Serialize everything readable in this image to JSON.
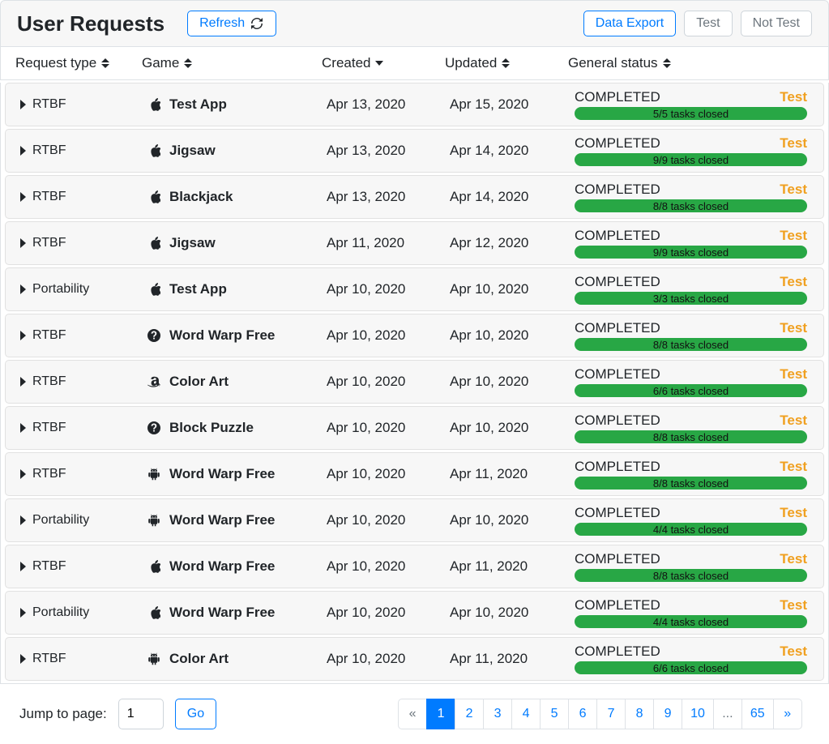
{
  "header": {
    "title": "User Requests",
    "refresh_label": "Refresh",
    "export_label": "Data Export",
    "test_label": "Test",
    "not_test_label": "Not Test"
  },
  "columns": {
    "type": "Request type",
    "game": "Game",
    "created": "Created",
    "updated": "Updated",
    "status": "General status"
  },
  "rows": [
    {
      "type": "RTBF",
      "platform": "apple",
      "game": "Test App",
      "created": "Apr 13, 2020",
      "updated": "Apr 15, 2020",
      "status": "COMPLETED",
      "badge": "Test",
      "tasks": "5/5 tasks closed"
    },
    {
      "type": "RTBF",
      "platform": "apple",
      "game": "Jigsaw",
      "created": "Apr 13, 2020",
      "updated": "Apr 14, 2020",
      "status": "COMPLETED",
      "badge": "Test",
      "tasks": "9/9 tasks closed"
    },
    {
      "type": "RTBF",
      "platform": "apple",
      "game": "Blackjack",
      "created": "Apr 13, 2020",
      "updated": "Apr 14, 2020",
      "status": "COMPLETED",
      "badge": "Test",
      "tasks": "8/8 tasks closed"
    },
    {
      "type": "RTBF",
      "platform": "apple",
      "game": "Jigsaw",
      "created": "Apr 11, 2020",
      "updated": "Apr 12, 2020",
      "status": "COMPLETED",
      "badge": "Test",
      "tasks": "9/9 tasks closed"
    },
    {
      "type": "Portability",
      "platform": "apple",
      "game": "Test App",
      "created": "Apr 10, 2020",
      "updated": "Apr 10, 2020",
      "status": "COMPLETED",
      "badge": "Test",
      "tasks": "3/3 tasks closed"
    },
    {
      "type": "RTBF",
      "platform": "help",
      "game": "Word Warp Free",
      "created": "Apr 10, 2020",
      "updated": "Apr 10, 2020",
      "status": "COMPLETED",
      "badge": "Test",
      "tasks": "8/8 tasks closed"
    },
    {
      "type": "RTBF",
      "platform": "amazon",
      "game": "Color Art",
      "created": "Apr 10, 2020",
      "updated": "Apr 10, 2020",
      "status": "COMPLETED",
      "badge": "Test",
      "tasks": "6/6 tasks closed"
    },
    {
      "type": "RTBF",
      "platform": "help",
      "game": "Block Puzzle",
      "created": "Apr 10, 2020",
      "updated": "Apr 10, 2020",
      "status": "COMPLETED",
      "badge": "Test",
      "tasks": "8/8 tasks closed"
    },
    {
      "type": "RTBF",
      "platform": "android",
      "game": "Word Warp Free",
      "created": "Apr 10, 2020",
      "updated": "Apr 11, 2020",
      "status": "COMPLETED",
      "badge": "Test",
      "tasks": "8/8 tasks closed"
    },
    {
      "type": "Portability",
      "platform": "android",
      "game": "Word Warp Free",
      "created": "Apr 10, 2020",
      "updated": "Apr 10, 2020",
      "status": "COMPLETED",
      "badge": "Test",
      "tasks": "4/4 tasks closed"
    },
    {
      "type": "RTBF",
      "platform": "apple",
      "game": "Word Warp Free",
      "created": "Apr 10, 2020",
      "updated": "Apr 11, 2020",
      "status": "COMPLETED",
      "badge": "Test",
      "tasks": "8/8 tasks closed"
    },
    {
      "type": "Portability",
      "platform": "apple",
      "game": "Word Warp Free",
      "created": "Apr 10, 2020",
      "updated": "Apr 10, 2020",
      "status": "COMPLETED",
      "badge": "Test",
      "tasks": "4/4 tasks closed"
    },
    {
      "type": "RTBF",
      "platform": "android",
      "game": "Color Art",
      "created": "Apr 10, 2020",
      "updated": "Apr 11, 2020",
      "status": "COMPLETED",
      "badge": "Test",
      "tasks": "6/6 tasks closed"
    }
  ],
  "pager": {
    "jump_label": "Jump to page:",
    "jump_value": "1",
    "go_label": "Go",
    "ellipsis": "...",
    "pages": [
      "1",
      "2",
      "3",
      "4",
      "5",
      "6",
      "7",
      "8",
      "9",
      "10"
    ],
    "last": "65",
    "first_icon": "«",
    "next_icon": "»"
  }
}
